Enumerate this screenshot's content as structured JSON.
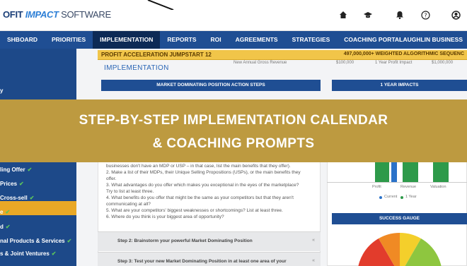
{
  "app": {
    "logo_prefix": "OFIT",
    "logo_accent": "IMPACT",
    "logo_suffix": "SOFTWARE"
  },
  "topbar_icons": [
    "home-icon",
    "graduation-cap-icon",
    "bell-icon",
    "help-icon",
    "user-icon"
  ],
  "nav": {
    "items": [
      "SHBOARD",
      "PRIORITIES",
      "IMPLEMENTATION",
      "REPORTS",
      "ROI",
      "AGREEMENTS",
      "STRATEGIES",
      "COACHING PORTAL"
    ],
    "active": "IMPLEMENTATION",
    "right_label": "LAUGHLIN BUSINESS"
  },
  "sidebar": {
    "items": [
      "y",
      "ling Offer",
      "Prices",
      "Cross-sell",
      "e",
      "d",
      "nal Products & Services",
      "s & Joint Ventures"
    ]
  },
  "jumpstart_bar": {
    "title": "PROFIT ACCELERATION JUMPSTART 12",
    "right": "497,000,000+ WEIGHTED ALGORITHMIC SEQUENC"
  },
  "implementation_title": "IMPLEMENTATION",
  "header_fragments": [
    "New Annual Gross Revenue",
    "$100,000",
    "1 Year Profit Impact",
    "$1,000,000"
  ],
  "action_steps_header": "MARKET DOMINATING POSITION ACTION STEPS",
  "impacts_header": "1 YEAR IMPACTS",
  "steps_text": [
    "businesses don't have an MDP or USP – in that case, list the main benefits that they offer).",
    "2.  Make a list of their MDPs, their Unique Selling Propositions (USPs), or the main benefits they",
    "offer.",
    "3.  What advantages do you offer which makes you exceptional in the eyes of the marketplace?",
    "Try to list at least three.",
    "4.  What benefits do you offer that might be the same as your competitors but that they aren't",
    "communicating at all?",
    "5.  What are your competitors' biggest weaknesses or shortcomings? List at least three.",
    "6.  Where do you think is your biggest area of opportunity?"
  ],
  "step2": "Step 2: Brainstorm your powerful Market Dominating Position",
  "step3": "Step 3: Test your new Market Dominating Position in at least one area of your",
  "chart": {
    "categories": [
      "Profit",
      "Revenue",
      "Valuation"
    ],
    "legend": [
      "Current",
      "1 Year"
    ],
    "colors": {
      "current": "#2b72c9",
      "year": "#2e9a4a"
    }
  },
  "gauge_header": "SUCCESS GAUGE",
  "banner": {
    "line1": "STEP-BY-STEP IMPLEMENTATION CALENDAR",
    "line2": "& COACHING PROMPTS"
  }
}
